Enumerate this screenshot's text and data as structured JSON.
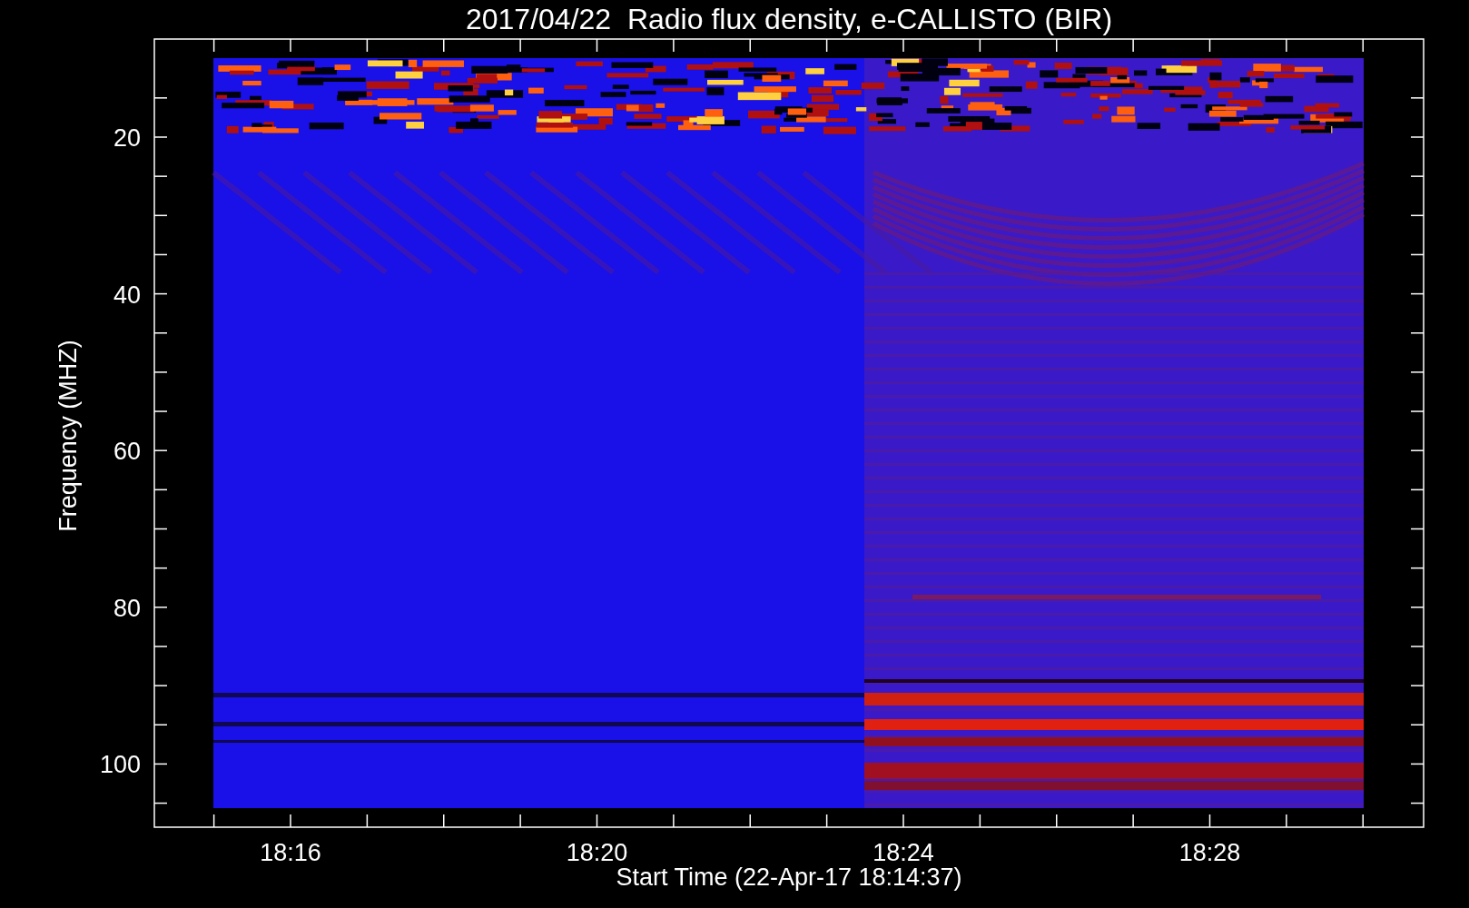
{
  "title": "2017/04/22  Radio flux density, e-CALLISTO (BIR)",
  "y_axis": {
    "label": "Frequency (MHZ)",
    "ticks": [
      "20",
      "40",
      "60",
      "80",
      "100"
    ]
  },
  "x_axis": {
    "label": "Start Time (22-Apr-17 18:14:37)",
    "ticks": [
      "18:16",
      "18:20",
      "18:24",
      "18:28"
    ]
  }
}
